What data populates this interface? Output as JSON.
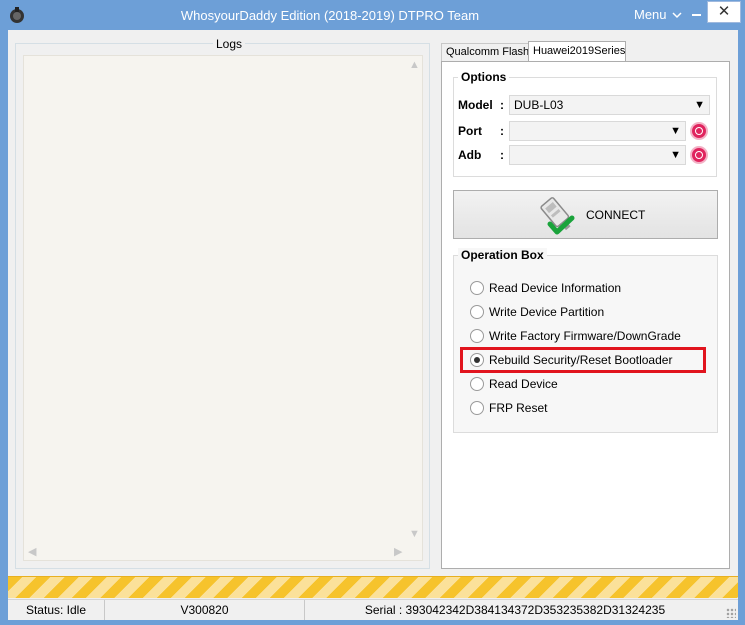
{
  "window": {
    "title": "WhosyourDaddy Edition (2018-2019) DTPRO Team",
    "menu_label": "Menu",
    "close_glyph": "✕"
  },
  "logs": {
    "title": "Logs"
  },
  "tabs": [
    {
      "label": "Qualcomm Flash",
      "active": false
    },
    {
      "label": "Huawei2019Series",
      "active": true
    }
  ],
  "options": {
    "title": "Options",
    "model_label": "Model",
    "model_value": "DUB-L03",
    "port_label": "Port",
    "port_value": "",
    "adb_label": "Adb",
    "adb_value": "",
    "colon": ":"
  },
  "connect": {
    "label": "CONNECT"
  },
  "operation_box": {
    "title": "Operation Box",
    "items": [
      {
        "label": "Read Device Information",
        "checked": false
      },
      {
        "label": "Write Device Partition",
        "checked": false
      },
      {
        "label": "Write Factory Firmware/DownGrade",
        "checked": false
      },
      {
        "label": "Rebuild Security/Reset Bootloader",
        "checked": true
      },
      {
        "label": "Read Device",
        "checked": false
      },
      {
        "label": "FRP Reset",
        "checked": false
      }
    ]
  },
  "statusbar": {
    "status": "Status: Idle",
    "version": "V300820",
    "serial": "Serial : 393042342D384134372D353235382D31324235"
  },
  "colors": {
    "titlebar": "#6d9fd7",
    "highlight": "#e1141e",
    "progress": "#f6c32c"
  }
}
